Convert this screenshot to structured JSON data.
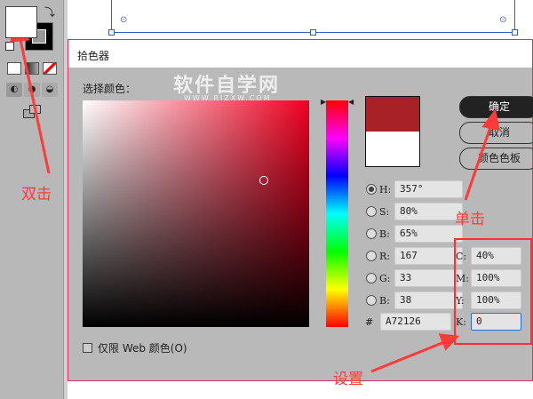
{
  "dialog": {
    "title": "拾色器",
    "select_color_label": "选择颜色：",
    "web_only_label": "仅限 Web 颜色(O)",
    "watermark": "软件自学网",
    "watermark_url": "WWW.RJZXW.COM"
  },
  "colors": {
    "new": "#A72126",
    "old": "#FFFFFF",
    "accent": "#ff3a3a"
  },
  "fields": {
    "hsb": [
      {
        "label": "H:",
        "value": "357°",
        "selected": true
      },
      {
        "label": "S:",
        "value": "80%"
      },
      {
        "label": "B:",
        "value": "65%"
      }
    ],
    "rgb": [
      {
        "label": "R:",
        "value": "167"
      },
      {
        "label": "G:",
        "value": "33"
      },
      {
        "label": "B:",
        "value": "38"
      }
    ],
    "hex": {
      "label": "#",
      "value": "A72126"
    },
    "cmyk": [
      {
        "label": "C:",
        "value": "40%"
      },
      {
        "label": "M:",
        "value": "100%"
      },
      {
        "label": "Y:",
        "value": "100%"
      },
      {
        "label": "K:",
        "value": "0"
      }
    ]
  },
  "buttons": {
    "ok": "确定",
    "cancel": "取消",
    "swatches": "颜色色板"
  },
  "annotations": {
    "double_click": "双击",
    "single_click": "单击",
    "set": "设置"
  }
}
